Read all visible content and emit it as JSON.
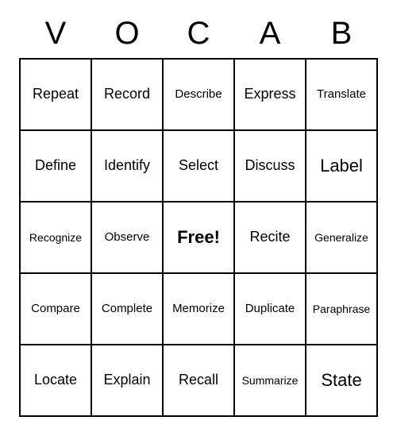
{
  "header": [
    "V",
    "O",
    "C",
    "A",
    "B"
  ],
  "grid": [
    [
      "Repeat",
      "Record",
      "Describe",
      "Express",
      "Translate"
    ],
    [
      "Define",
      "Identify",
      "Select",
      "Discuss",
      "Label"
    ],
    [
      "Recognize",
      "Observe",
      "Free!",
      "Recite",
      "Generalize"
    ],
    [
      "Compare",
      "Complete",
      "Memorize",
      "Duplicate",
      "Paraphrase"
    ],
    [
      "Locate",
      "Explain",
      "Recall",
      "Summarize",
      "State"
    ]
  ]
}
